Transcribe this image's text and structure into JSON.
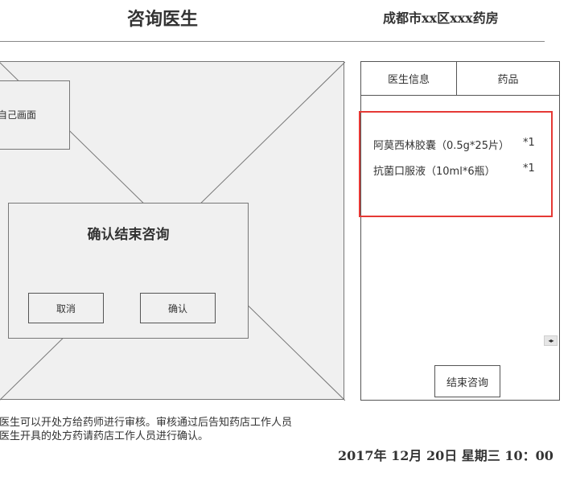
{
  "header": {
    "title": "咨询医生",
    "pharmacy": "成都市xx区xxx药房"
  },
  "video": {
    "self_view_label": "自己画面"
  },
  "dialog": {
    "title": "确认结束咨询",
    "cancel_label": "取消",
    "confirm_label": "确认"
  },
  "panel": {
    "tabs": [
      {
        "label": "医生信息"
      },
      {
        "label": "药品"
      }
    ],
    "drugs": [
      {
        "name": "阿莫西林胶囊（0.5g*25片）",
        "qty": "*1"
      },
      {
        "name": "抗菌口服液（10ml*6瓶）",
        "qty": "*1"
      }
    ],
    "end_button_label": "结束咨询",
    "scroll_control_icon": "left-right-arrows-icon"
  },
  "notes": {
    "line1": "医生可以开处方给药师进行审核。审核通过后告知药店工作人员",
    "line2": "医生开具的处方药请药店工作人员进行确认。"
  },
  "footer": {
    "datetime": "2017年 12月 20日  星期三  10：00"
  },
  "colors": {
    "highlight": "#e53935",
    "placeholder_fill": "#f0f0f0",
    "border": "#555555"
  }
}
